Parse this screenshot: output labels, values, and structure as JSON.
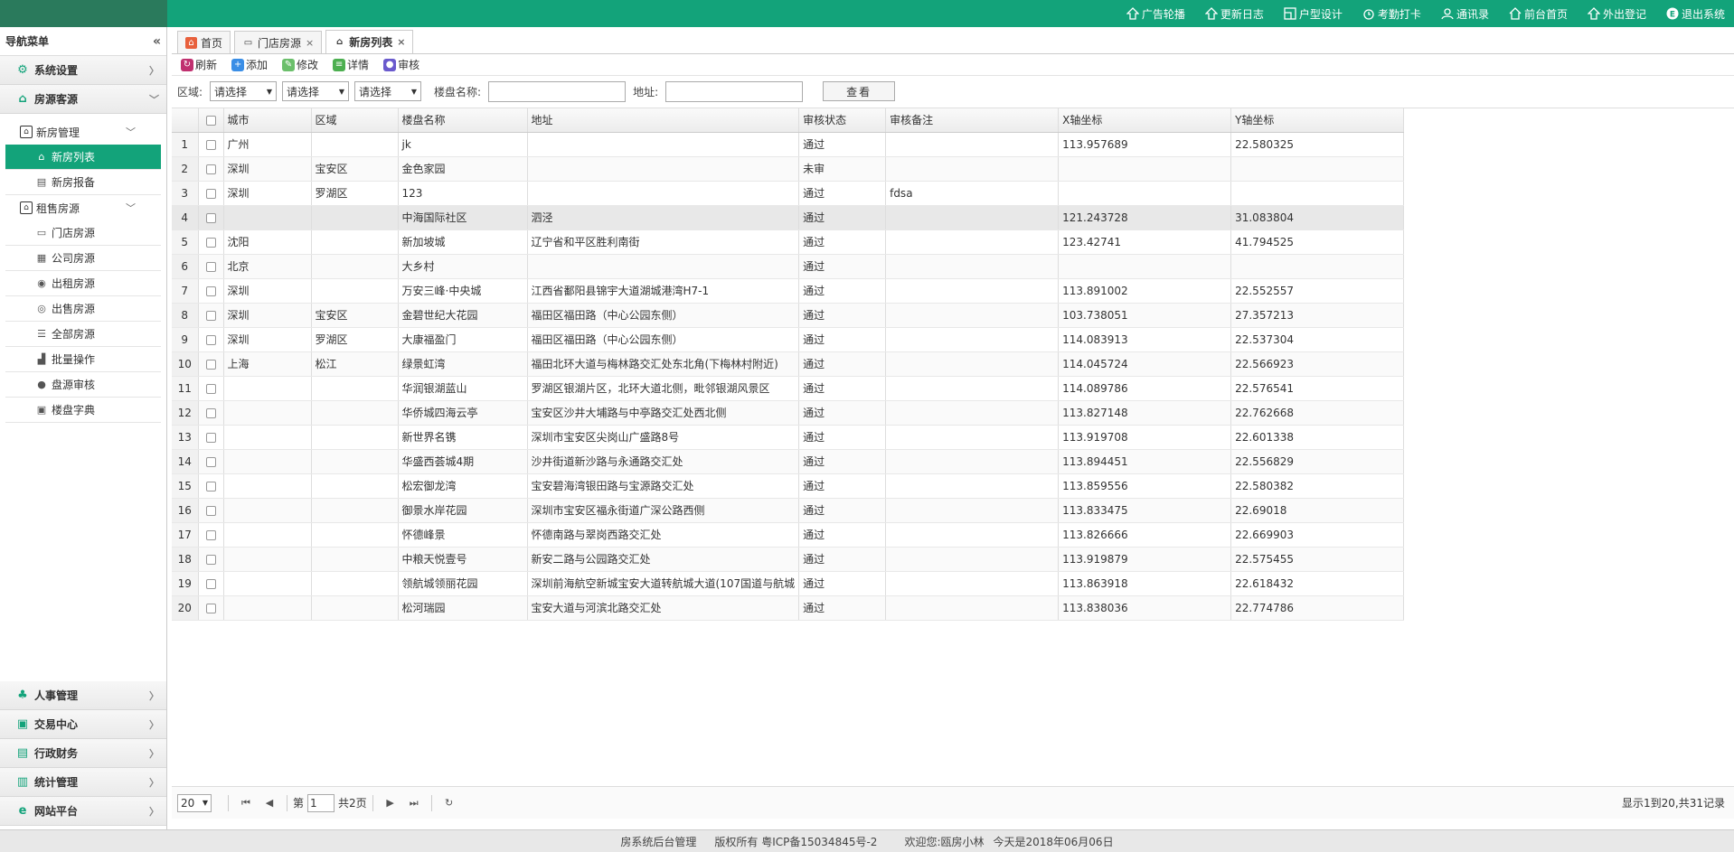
{
  "topnav": [
    {
      "label": "广告轮播",
      "icon": "home-up-icon"
    },
    {
      "label": "更新日志",
      "icon": "home-up-icon"
    },
    {
      "label": "户型设计",
      "icon": "layout-icon"
    },
    {
      "label": "考勤打卡",
      "icon": "clock-icon"
    },
    {
      "label": "通讯录",
      "icon": "contacts-icon"
    },
    {
      "label": "前台首页",
      "icon": "home-icon"
    },
    {
      "label": "外出登记",
      "icon": "home-up-icon"
    },
    {
      "label": "退出系统",
      "icon": "logout-icon"
    }
  ],
  "sidebar": {
    "title": "导航菜单",
    "system": "系统设置",
    "housing": "房源客源",
    "new_house_group": "新房管理",
    "new_house_list": "新房列表",
    "new_house_report": "新房报备",
    "rent_sale_group": "租售房源",
    "store_house": "门店房源",
    "company_house": "公司房源",
    "rent_house": "出租房源",
    "sale_house": "出售房源",
    "all_house": "全部房源",
    "batch_ops": "批量操作",
    "house_audit": "盘源审核",
    "building_dict": "楼盘字典",
    "hr": "人事管理",
    "trade": "交易中心",
    "finance": "行政财务",
    "stats": "统计管理",
    "website": "网站平台"
  },
  "tabs": {
    "home": "首页",
    "store": "门店房源",
    "newlist": "新房列表"
  },
  "toolbar": {
    "refresh": "刷新",
    "add": "添加",
    "edit": "修改",
    "detail": "详情",
    "audit": "审核"
  },
  "filter": {
    "region_label": "区域:",
    "select1": "请选择",
    "select2": "请选择",
    "select3": "请选择",
    "building_label": "楼盘名称:",
    "address_label": "地址:",
    "search_btn": "查看"
  },
  "table": {
    "headers": [
      "城市",
      "区域",
      "楼盘名称",
      "地址",
      "审核状态",
      "审核备注",
      "X轴坐标",
      "Y轴坐标"
    ],
    "rows": [
      [
        "1",
        "广州",
        "",
        "jk",
        "",
        "通过",
        "",
        "113.957689",
        "22.580325"
      ],
      [
        "2",
        "深圳",
        "宝安区",
        "金色家园",
        "",
        "未审",
        "",
        "",
        ""
      ],
      [
        "3",
        "深圳",
        "罗湖区",
        "123",
        "",
        "通过",
        "fdsa",
        "",
        ""
      ],
      [
        "4",
        "",
        "",
        "中海国际社区",
        "泗泾",
        "通过",
        "",
        "121.243728",
        "31.083804"
      ],
      [
        "5",
        "沈阳",
        "",
        "新加坡城",
        "辽宁省和平区胜利南街",
        "通过",
        "",
        "123.42741",
        "41.794525"
      ],
      [
        "6",
        "北京",
        "",
        "大乡村",
        "",
        "通过",
        "",
        "",
        ""
      ],
      [
        "7",
        "深圳",
        "",
        "万安三峰·中央城",
        "江西省鄱阳县锦宇大道湖城港湾H7-1",
        "通过",
        "",
        "113.891002",
        "22.552557"
      ],
      [
        "8",
        "深圳",
        "宝安区",
        "金碧世纪大花园",
        "福田区福田路（中心公园东侧）",
        "通过",
        "",
        "103.738051",
        "27.357213"
      ],
      [
        "9",
        "深圳",
        "罗湖区",
        "大康福盈门",
        "福田区福田路（中心公园东侧）",
        "通过",
        "",
        "114.083913",
        "22.537304"
      ],
      [
        "10",
        "上海",
        "松江",
        "绿景虹湾",
        "福田北环大道与梅林路交汇处东北角(下梅林村附近)",
        "通过",
        "",
        "114.045724",
        "22.566923"
      ],
      [
        "11",
        "",
        "",
        "华润银湖蓝山",
        "罗湖区银湖片区，北环大道北侧，毗邻银湖风景区",
        "通过",
        "",
        "114.089786",
        "22.576541"
      ],
      [
        "12",
        "",
        "",
        "华侨城四海云亭",
        "宝安区沙井大埔路与中亭路交汇处西北侧",
        "通过",
        "",
        "113.827148",
        "22.762668"
      ],
      [
        "13",
        "",
        "",
        "新世界名镌",
        "深圳市宝安区尖岗山广盛路8号",
        "通过",
        "",
        "113.919708",
        "22.601338"
      ],
      [
        "14",
        "",
        "",
        "华盛西荟城4期",
        "沙井街道新沙路与永通路交汇处",
        "通过",
        "",
        "113.894451",
        "22.556829"
      ],
      [
        "15",
        "",
        "",
        "松宏御龙湾",
        "宝安碧海湾银田路与宝源路交汇处",
        "通过",
        "",
        "113.859556",
        "22.580382"
      ],
      [
        "16",
        "",
        "",
        "御景水岸花园",
        "深圳市宝安区福永街道广深公路西侧",
        "通过",
        "",
        "113.833475",
        "22.69018"
      ],
      [
        "17",
        "",
        "",
        "怀德峰景",
        "怀德南路与翠岗西路交汇处",
        "通过",
        "",
        "113.826666",
        "22.669903"
      ],
      [
        "18",
        "",
        "",
        "中粮天悦壹号",
        "新安二路与公园路交汇处",
        "通过",
        "",
        "113.919879",
        "22.575455"
      ],
      [
        "19",
        "",
        "",
        "领航城领丽花园",
        "深圳前海航空新城宝安大道转航城大道(107国道与航城",
        "通过",
        "",
        "113.863918",
        "22.618432"
      ],
      [
        "20",
        "",
        "",
        "松河瑞园",
        "宝安大道与河滨北路交汇处",
        "通过",
        "",
        "113.838036",
        "22.774786"
      ]
    ]
  },
  "pager": {
    "page_size": "20",
    "page_prefix": "第",
    "page_value": "1",
    "page_suffix": "共2页",
    "info": "显示1到20,共31记录"
  },
  "footer": {
    "system": "房系统后台管理",
    "copyright": "版权所有 粤ICP备15034845号-2",
    "welcome": "欢迎您:瓯房小林",
    "today": "今天是2018年06月06日"
  }
}
